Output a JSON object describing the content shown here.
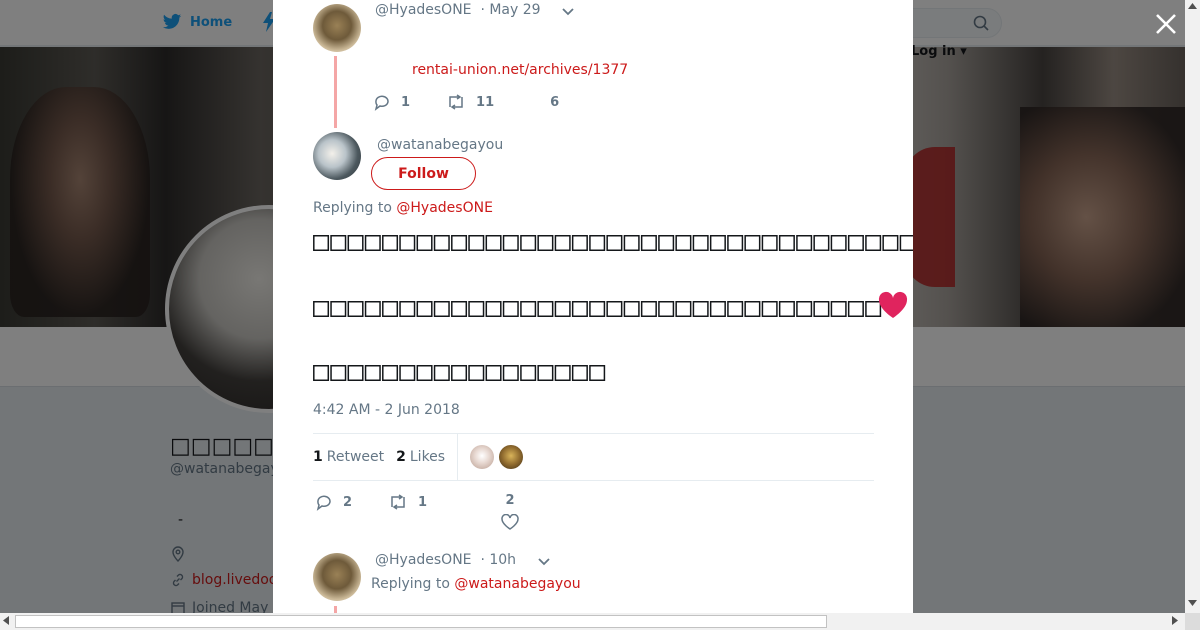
{
  "nav": {
    "home_label": "Home",
    "login_label": "Log in"
  },
  "profile": {
    "name": "□□□□□",
    "handle": "@watanabegayou",
    "dash": "-",
    "link_text": "blog.livedoo",
    "joined_text": "Joined May"
  },
  "modal": {
    "tweet1": {
      "handle": "@HyadesONE",
      "time": "· May 29",
      "link": "rentai-union.net/archives/1377",
      "replies": "1",
      "retweets": "11",
      "likes": "6"
    },
    "main_tweet": {
      "handle": "@watanabegayou",
      "follow_label": "Follow",
      "replying_prefix": "Replying to",
      "replying_to": "@HyadesONE",
      "line1": "□□□□□□□□□□□□□□□□□□□□□□□□□□□□□□□□□□□□□□□□□□□□□□□",
      "line2": "□□□□□□□□□□□□□□□□□□□□□□□□□□□□□□□□□",
      "line3": "□□□□□□□□□□□□□□□□□",
      "timestamp": "4:42 AM - 2 Jun 2018",
      "retweet_count": "1",
      "retweet_label": "Retweet",
      "like_count": "2",
      "like_label": "Likes",
      "replies": "2",
      "retweets": "1",
      "likes": "2"
    },
    "tweet3": {
      "handle": "@HyadesONE",
      "time": "· 10h",
      "replying_prefix": "Replying to",
      "replying_to": "@watanabegayou"
    }
  },
  "colors": {
    "accent": "#cc1a1a",
    "twitter_blue": "#1da1f2",
    "muted": "#657786",
    "heart": "#e0245e"
  }
}
